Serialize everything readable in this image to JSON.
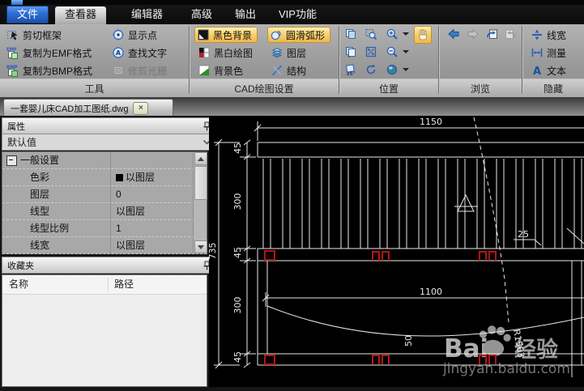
{
  "menu": {
    "file": "文件",
    "items": [
      "查看器",
      "编辑器",
      "高级",
      "输出",
      "VIP功能"
    ]
  },
  "ribbon": {
    "tools": {
      "label": "工具",
      "cut_frame": "剪切框架",
      "copy_emf": "复制为EMF格式",
      "copy_bmp": "复制为BMP格式",
      "emf_tag": "EMF",
      "bmp_tag": "BMP",
      "show_points": "显示点",
      "find_text": "查找文字",
      "trim_raster": "修剪光栅"
    },
    "cad": {
      "label": "CAD绘图设置",
      "black_bg": "黑色背景",
      "bw_draw": "黑白绘图",
      "bg_color": "背景色",
      "smooth_arc": "圆滑弧形",
      "layers": "图层",
      "structure": "结构"
    },
    "position": {
      "label": "位置",
      "rotate_tag": "35°"
    },
    "browse": {
      "label": "浏览"
    },
    "hide": {
      "label": "隐藏",
      "linewidth": "线宽",
      "measure": "测量",
      "text": "文本"
    }
  },
  "tab": {
    "title": "一套婴儿床CAD加工图纸.dwg",
    "close": "×"
  },
  "properties": {
    "header": "属性",
    "preset": "默认值",
    "group_label": "一般设置",
    "rows": [
      {
        "label": "色彩",
        "value": "以图层"
      },
      {
        "label": "图层",
        "value": "0"
      },
      {
        "label": "线型",
        "value": "以图层"
      },
      {
        "label": "线型比例",
        "value": "1"
      },
      {
        "label": "线宽",
        "value": "以图层"
      }
    ]
  },
  "favorites": {
    "header": "收藏夹",
    "name_col": "名称",
    "path_col": "路径"
  },
  "drawing": {
    "dims": {
      "width": "1150",
      "height": "735",
      "s45a": "45",
      "s300a": "300",
      "s45b": "45",
      "s300b": "300",
      "s45c": "45",
      "inner": "1100",
      "sag": "50",
      "gap": "25",
      "radius": "R1563"
    }
  },
  "watermark": {
    "brand": "Bai",
    "brand2": "经验",
    "url": "jingyan.baidu.com"
  },
  "colors": {
    "highlight": "#f0b64d",
    "accent_blue": "#2b6cd4",
    "marker_red": "#b31515",
    "bg_black": "#000000"
  }
}
